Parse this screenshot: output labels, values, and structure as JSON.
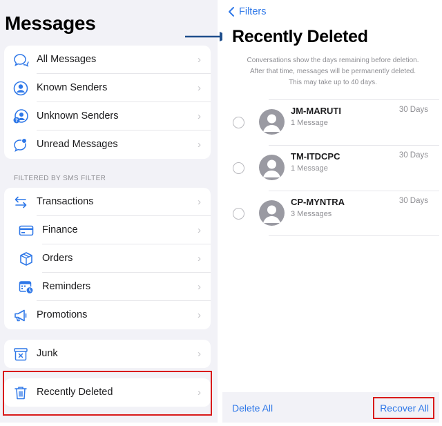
{
  "left": {
    "title": "Messages",
    "group1": [
      {
        "label": "All Messages",
        "icon": "chat-bubbles-icon"
      },
      {
        "label": "Known Senders",
        "icon": "person-circle-icon"
      },
      {
        "label": "Unknown Senders",
        "icon": "person-question-icon"
      },
      {
        "label": "Unread Messages",
        "icon": "unread-bubble-icon"
      }
    ],
    "section_label": "FILTERED BY SMS FILTER",
    "group2": [
      {
        "label": "Transactions",
        "icon": "arrows-swap-icon"
      },
      {
        "label": "Finance",
        "icon": "credit-card-icon"
      },
      {
        "label": "Orders",
        "icon": "box-icon"
      },
      {
        "label": "Reminders",
        "icon": "calendar-clock-icon"
      },
      {
        "label": "Promotions",
        "icon": "megaphone-icon"
      }
    ],
    "group3": [
      {
        "label": "Junk",
        "icon": "junk-bin-icon"
      }
    ],
    "group4": [
      {
        "label": "Recently Deleted",
        "icon": "trash-icon"
      }
    ],
    "chevron": "›"
  },
  "right": {
    "back_label": "Filters",
    "title": "Recently Deleted",
    "note_lines": [
      "Conversations show the days remaining before deletion.",
      "After that time, messages will be permanently deleted.",
      "This may take up to 40 days."
    ],
    "messages": [
      {
        "name": "JM-MARUTI",
        "count": "1 Message",
        "days": "30 Days"
      },
      {
        "name": "TM-ITDCPC",
        "count": "1 Message",
        "days": "30 Days"
      },
      {
        "name": "CP-MYNTRA",
        "count": "3 Messages",
        "days": "30 Days"
      }
    ],
    "toolbar": {
      "delete_all": "Delete All",
      "recover_all": "Recover All"
    }
  },
  "colors": {
    "accent": "#2f78e8",
    "highlight": "#d91a1a",
    "arrow": "#1f4e8c"
  }
}
